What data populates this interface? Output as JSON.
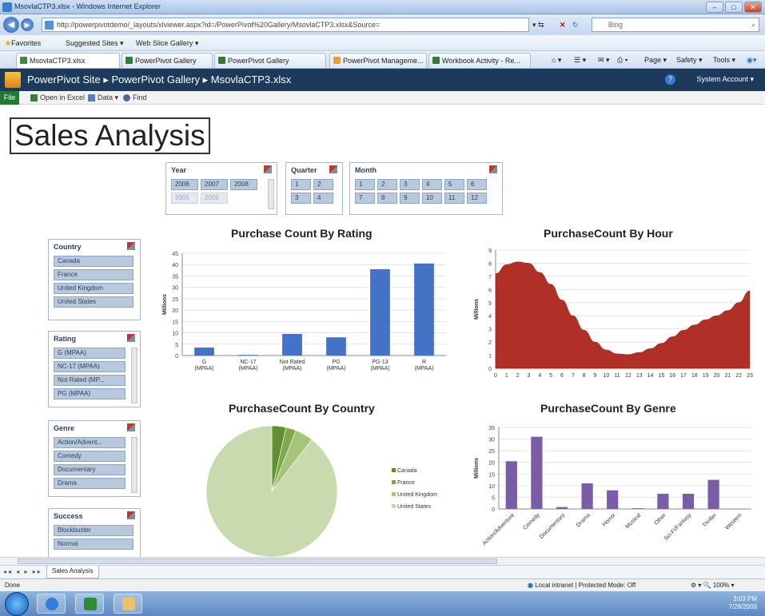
{
  "window": {
    "title": "MsovlaCTP3.xlsx - Windows Internet Explorer"
  },
  "address": {
    "url": "http://powerpivotdemo/_layouts/xlviewer.aspx?id=/PowerPivot%20Gallery/MsovlaCTP3.xlsx&Source=",
    "search_placeholder": "Bing"
  },
  "favorites": {
    "label": "Favorites",
    "items": [
      "Suggested Sites ▾",
      "Web Slice Gallery ▾"
    ]
  },
  "tabs": [
    {
      "label": "MsovlaCTP3.xlsx"
    },
    {
      "label": "PowerPivot Gallery"
    },
    {
      "label": "PowerPivot Gallery"
    },
    {
      "label": "PowerPivot Manageme..."
    },
    {
      "label": "Workbook Activity - Re..."
    }
  ],
  "command_bar": {
    "page": "Page ▾",
    "safety": "Safety ▾",
    "tools": "Tools ▾"
  },
  "sharepoint": {
    "breadcrumb": "PowerPivot Site ▸ PowerPivot Gallery ▸ MsovlaCTP3.xlsx",
    "user": "System Account ▾",
    "help": "?"
  },
  "ribbon": {
    "file": "File",
    "open_in_excel": "Open in Excel",
    "data": "Data ▾",
    "find": "Find"
  },
  "report": {
    "title": "Sales Analysis"
  },
  "slicers": {
    "year": {
      "header": "Year",
      "items": [
        {
          "label": "2006"
        },
        {
          "label": "2007"
        },
        {
          "label": "2008"
        },
        {
          "label": "2005",
          "dim": true
        },
        {
          "label": "2009",
          "dim": true
        }
      ]
    },
    "quarter": {
      "header": "Quarter",
      "items": [
        "1",
        "2",
        "3",
        "4"
      ]
    },
    "month": {
      "header": "Month",
      "items": [
        "1",
        "2",
        "3",
        "4",
        "5",
        "6",
        "7",
        "8",
        "9",
        "10",
        "11",
        "12"
      ]
    },
    "country": {
      "header": "Country",
      "items": [
        "Canada",
        "France",
        "United Kingdom",
        "United States"
      ]
    },
    "rating": {
      "header": "Rating",
      "items": [
        "G (MPAA)",
        "NC-17 (MPAA)",
        "Not Rated (MP...",
        "PG (MPAA)"
      ]
    },
    "genre": {
      "header": "Genre",
      "items": [
        "Action/Advent...",
        "Comedy",
        "Documentary",
        "Drama"
      ]
    },
    "success": {
      "header": "Success",
      "items": [
        "Blockbuster",
        "Normal"
      ]
    }
  },
  "charts": {
    "rating": {
      "title": "Purchase Count By Rating"
    },
    "hour": {
      "title": "PurchaseCount By Hour"
    },
    "country": {
      "title": "PurchaseCount By Country"
    },
    "genre": {
      "title": "PurchaseCount By Genre"
    }
  },
  "chart_data": [
    {
      "type": "bar",
      "title": "Purchase Count By Rating",
      "ylabel": "Millions",
      "ylim": [
        0,
        45
      ],
      "yticks": [
        0,
        5,
        10,
        15,
        20,
        25,
        30,
        35,
        40,
        45
      ],
      "categories": [
        "G (MPAA)",
        "NC-17 (MPAA)",
        "Not Rated (MPAA)",
        "PG (MPAA)",
        "PG-13 (MPAA)",
        "R (MPAA)"
      ],
      "values": [
        3.5,
        0.3,
        9.5,
        8,
        38,
        40.5
      ],
      "color": "#4472c4"
    },
    {
      "type": "area",
      "title": "PurchaseCount By Hour",
      "ylabel": "Millions",
      "ylim": [
        0,
        9
      ],
      "yticks": [
        0,
        1,
        2,
        3,
        4,
        5,
        6,
        7,
        8,
        9
      ],
      "x": [
        0,
        1,
        2,
        3,
        4,
        5,
        6,
        7,
        8,
        9,
        10,
        11,
        12,
        13,
        14,
        15,
        16,
        17,
        18,
        19,
        20,
        21,
        22,
        23
      ],
      "values": [
        7.2,
        7.9,
        8.1,
        8.0,
        7.3,
        6.4,
        5.2,
        4.0,
        2.9,
        2.0,
        1.4,
        1.1,
        1.05,
        1.2,
        1.5,
        1.9,
        2.4,
        2.9,
        3.3,
        3.7,
        4.0,
        4.4,
        5.0,
        5.9
      ],
      "color": "#b03028"
    },
    {
      "type": "pie",
      "title": "PurchaseCount By Country",
      "legend": "right",
      "slices": [
        {
          "label": "Canada",
          "value": 3.5,
          "color": "#5f8f2f"
        },
        {
          "label": "France",
          "value": 2.5,
          "color": "#7fa84a"
        },
        {
          "label": "United Kingdom",
          "value": 4.5,
          "color": "#a6c47a"
        },
        {
          "label": "United States",
          "value": 89.5,
          "color": "#c9dbae"
        }
      ]
    },
    {
      "type": "bar",
      "title": "PurchaseCount By Genre",
      "ylabel": "Millions",
      "ylim": [
        0,
        35
      ],
      "yticks": [
        0,
        5,
        10,
        15,
        20,
        25,
        30,
        35
      ],
      "categories": [
        "Action/Adventure",
        "Comedy",
        "Documentary",
        "Drama",
        "Horror",
        "Musical",
        "Other",
        "Sci-Fi/Fantasy",
        "Thriller",
        "Western"
      ],
      "values": [
        20.5,
        31,
        0.8,
        11,
        8,
        0.3,
        6.5,
        6.5,
        12.5,
        0
      ],
      "color": "#7b5ca6"
    }
  ],
  "sheet": {
    "tab": "Sales Analysis"
  },
  "status": {
    "left": "Done",
    "zone": "Local intranet | Protected Mode: Off",
    "zoom": "100%"
  },
  "taskbar": {
    "time": "3:03 PM",
    "date": "7/28/2009"
  }
}
